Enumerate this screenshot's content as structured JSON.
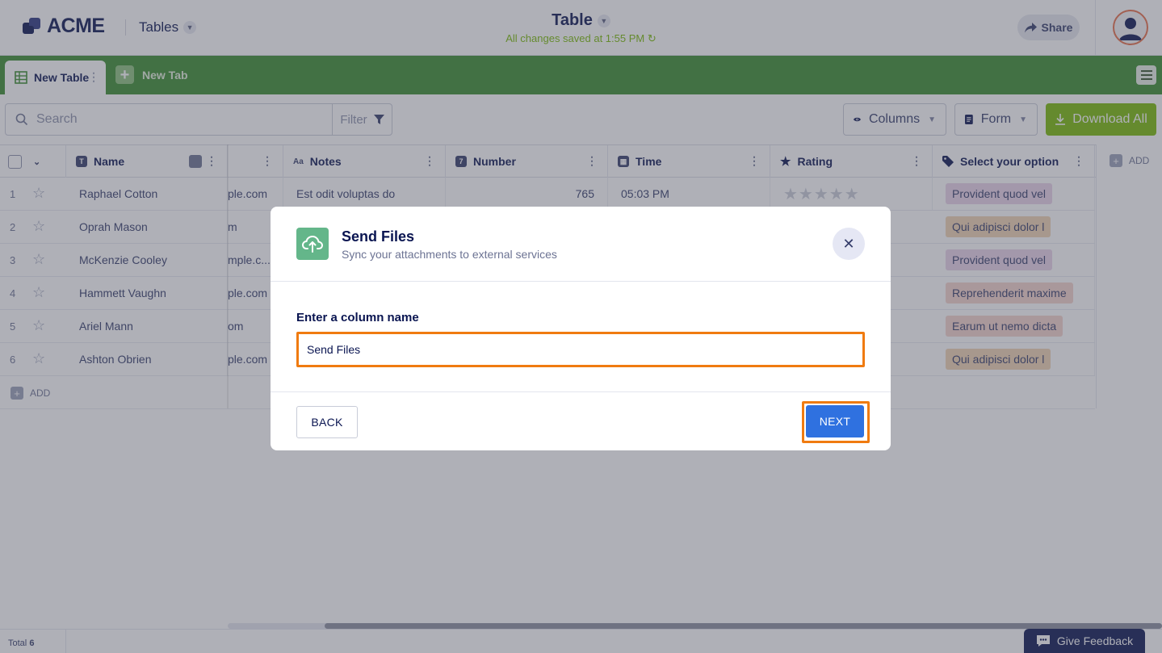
{
  "header": {
    "brand": "ACME",
    "app_menu": "Tables",
    "doc_title": "Table",
    "save_status": "All changes saved at 1:55 PM",
    "share_label": "Share"
  },
  "tabs": {
    "active": "New Table",
    "new_tab": "New Tab"
  },
  "toolbar": {
    "search_placeholder": "Search",
    "filter_label": "Filter",
    "columns_label": "Columns",
    "form_label": "Form",
    "download_label": "Download All"
  },
  "table": {
    "columns": [
      "Name",
      "Notes",
      "Number",
      "Time",
      "Rating",
      "Select your option"
    ],
    "add_column_label": "ADD",
    "rows": [
      {
        "num": "1",
        "name": "Raphael Cotton",
        "email": "ple.com",
        "notes": "Est odit voluptas do",
        "number": "765",
        "time": "05:03 PM",
        "option": "Provident quod vel",
        "option_color": "#ead4ea"
      },
      {
        "num": "2",
        "name": "Oprah Mason",
        "email": "m",
        "option": "Qui adipisci dolor l",
        "option_color": "#f1d4b2"
      },
      {
        "num": "3",
        "name": "McKenzie Cooley",
        "email": "mple.c...",
        "option": "Provident quod vel",
        "option_color": "#ead4ea"
      },
      {
        "num": "4",
        "name": "Hammett Vaughn",
        "email": "ple.com",
        "option": "Reprehenderit maxime",
        "option_color": "#f5d4cd"
      },
      {
        "num": "5",
        "name": "Ariel Mann",
        "email": "om",
        "option": "Earum ut nemo dicta",
        "option_color": "#f5d4cd"
      },
      {
        "num": "6",
        "name": "Ashton Obrien",
        "email": "ple.com",
        "option": "Qui adipisci dolor l",
        "option_color": "#f1d4b2"
      }
    ],
    "add_row_label": "ADD"
  },
  "footer": {
    "total_label": "Total",
    "total_count": "6",
    "feedback_label": "Give Feedback"
  },
  "modal": {
    "title": "Send Files",
    "subtitle": "Sync your attachments to external services",
    "field_label": "Enter a column name",
    "field_value": "Send Files",
    "back_label": "BACK",
    "next_label": "NEXT"
  },
  "colors": {
    "tabbar": "#3a8c2e",
    "accent_green": "#78bb07",
    "primary_blue": "#2f71e0",
    "highlight_orange": "#f07b10",
    "modal_icon": "#64b68a"
  }
}
